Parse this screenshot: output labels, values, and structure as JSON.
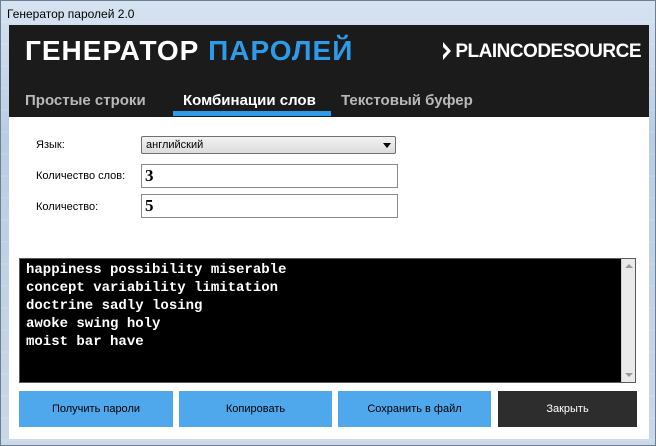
{
  "window": {
    "title": "Генератор паролей 2.0"
  },
  "header": {
    "title_part1": "ГЕНЕРАТОР",
    "title_part2": "ПАРОЛЕЙ",
    "vendor": "PLAINCODESOURCE"
  },
  "tabs": [
    {
      "label": "Простые строки",
      "active": false
    },
    {
      "label": "Комбинации слов",
      "active": true
    },
    {
      "label": "Текстовый буфер",
      "active": false
    }
  ],
  "form": {
    "language_label": "Язык:",
    "language_value": "английский",
    "word_count_label": "Количество слов:",
    "word_count_value": "3",
    "count_label": "Количество:",
    "count_value": "5"
  },
  "output": {
    "lines": [
      "happiness possibility miserable",
      "concept variability limitation",
      "doctrine sadly losing",
      "awoke swing holy",
      "moist bar have"
    ]
  },
  "buttons": {
    "get_passwords": "Получить пароли",
    "copy": "Копировать",
    "save_to_file": "Сохранить в файл",
    "close": "Закрыть"
  },
  "colors": {
    "accent": "#2e9be8",
    "header_bg": "#1b1b1b",
    "button_blue": "#4fa8ec",
    "button_dark": "#2d2d2d"
  }
}
